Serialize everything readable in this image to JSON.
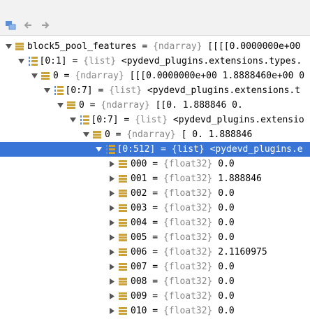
{
  "toolbar": {
    "icons": [
      "variables-icon",
      "back-arrow-icon",
      "forward-arrow-icon"
    ]
  },
  "rows": [
    {
      "name": "block5_pool_features",
      "eq": " = ",
      "type": "{ndarray}",
      "value": " [[[[0.0000000e+00",
      "icon": "ndarray",
      "expanded": true
    },
    {
      "name": "[0:1]",
      "eq": "  = ",
      "type": "{list}",
      "value": " <pydevd_plugins.extensions.types.",
      "icon": "list",
      "expanded": true
    },
    {
      "name": "0",
      "eq": " = ",
      "type": "{ndarray}",
      "value": " [[[0.0000000e+00 1.8888460e+00 0",
      "icon": "ndarray",
      "expanded": true
    },
    {
      "name": "[0:7]",
      "eq": "  = ",
      "type": "{list}",
      "value": " <pydevd_plugins.extensions.t",
      "icon": "list",
      "expanded": true
    },
    {
      "name": "0",
      "eq": " = ",
      "type": "{ndarray}",
      "value": " [[0.        1.888846  0.",
      "icon": "ndarray",
      "expanded": true
    },
    {
      "name": "[0:7]",
      "eq": "  = ",
      "type": "{list}",
      "value": " <pydevd_plugins.extensio",
      "icon": "list",
      "expanded": true
    },
    {
      "name": "0",
      "eq": " = ",
      "type": "{ndarray}",
      "value": " [ 0.          1.888846",
      "icon": "ndarray",
      "expanded": true
    },
    {
      "name": "[0:512]",
      "eq": "  = ",
      "type": "{list}",
      "value": " <pydevd_plugins.e",
      "icon": "list",
      "expanded": true,
      "selected": true
    },
    {
      "name": "000",
      "eq": " = ",
      "type": "{float32}",
      "value": " 0.0",
      "icon": "ndarray",
      "expanded": false
    },
    {
      "name": "001",
      "eq": " = ",
      "type": "{float32}",
      "value": " 1.888846",
      "icon": "ndarray",
      "expanded": false
    },
    {
      "name": "002",
      "eq": " = ",
      "type": "{float32}",
      "value": " 0.0",
      "icon": "ndarray",
      "expanded": false
    },
    {
      "name": "003",
      "eq": " = ",
      "type": "{float32}",
      "value": " 0.0",
      "icon": "ndarray",
      "expanded": false
    },
    {
      "name": "004",
      "eq": " = ",
      "type": "{float32}",
      "value": " 0.0",
      "icon": "ndarray",
      "expanded": false
    },
    {
      "name": "005",
      "eq": " = ",
      "type": "{float32}",
      "value": " 0.0",
      "icon": "ndarray",
      "expanded": false
    },
    {
      "name": "006",
      "eq": " = ",
      "type": "{float32}",
      "value": " 2.1160975",
      "icon": "ndarray",
      "expanded": false
    },
    {
      "name": "007",
      "eq": " = ",
      "type": "{float32}",
      "value": " 0.0",
      "icon": "ndarray",
      "expanded": false
    },
    {
      "name": "008",
      "eq": " = ",
      "type": "{float32}",
      "value": " 0.0",
      "icon": "ndarray",
      "expanded": false
    },
    {
      "name": "009",
      "eq": " = ",
      "type": "{float32}",
      "value": " 0.0",
      "icon": "ndarray",
      "expanded": false
    },
    {
      "name": "010",
      "eq": " = ",
      "type": "{float32}",
      "value": " 0.0",
      "icon": "ndarray",
      "expanded": false
    }
  ],
  "colors": {
    "selected_bg": "#3875d7",
    "ndarray_icon": "#c9a23a",
    "arrow": "#555555",
    "meta_text": "#888888"
  }
}
